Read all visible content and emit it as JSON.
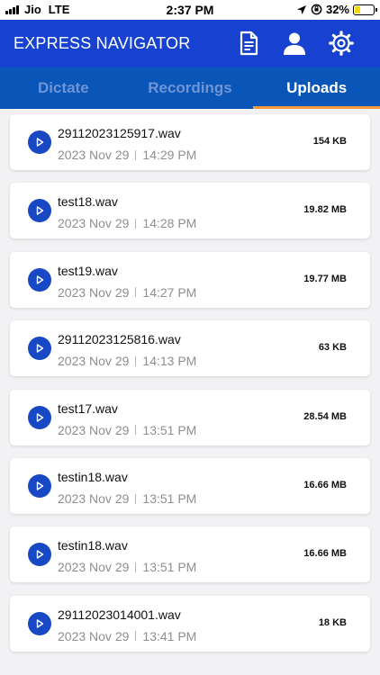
{
  "status_bar": {
    "carrier": "Jio",
    "network": "LTE",
    "time": "2:37 PM",
    "battery_percent": "32%",
    "battery_level": 0.32,
    "battery_color": "#f5d90a"
  },
  "header": {
    "title": "EXPRESS NAVIGATOR",
    "background": "#1742cf",
    "icons": [
      "document-icon",
      "user-icon",
      "settings-gear-icon"
    ]
  },
  "tabs": [
    {
      "label": "Dictate",
      "active": false
    },
    {
      "label": "Recordings",
      "active": false
    },
    {
      "label": "Uploads",
      "active": true
    }
  ],
  "colors": {
    "tab_bar": "#0a55b8",
    "tab_indicator": "#f39a3c",
    "play_button": "#1848c4"
  },
  "uploads": [
    {
      "name": "29112023125917.wav",
      "date": "2023 Nov 29",
      "time": "14:29 PM",
      "size": "154 KB"
    },
    {
      "name": "test18.wav",
      "date": "2023 Nov 29",
      "time": "14:28 PM",
      "size": "19.82 MB"
    },
    {
      "name": "test19.wav",
      "date": "2023 Nov 29",
      "time": "14:27 PM",
      "size": "19.77 MB"
    },
    {
      "name": "29112023125816.wav",
      "date": "2023 Nov 29",
      "time": "14:13 PM",
      "size": "63 KB"
    },
    {
      "name": "test17.wav",
      "date": "2023 Nov 29",
      "time": "13:51 PM",
      "size": "28.54 MB"
    },
    {
      "name": "testin18.wav",
      "date": "2023 Nov 29",
      "time": "13:51 PM",
      "size": "16.66 MB"
    },
    {
      "name": "testin18.wav",
      "date": "2023 Nov 29",
      "time": "13:51 PM",
      "size": "16.66 MB"
    },
    {
      "name": "29112023014001.wav",
      "date": "2023 Nov 29",
      "time": "13:41 PM",
      "size": "18 KB"
    }
  ]
}
